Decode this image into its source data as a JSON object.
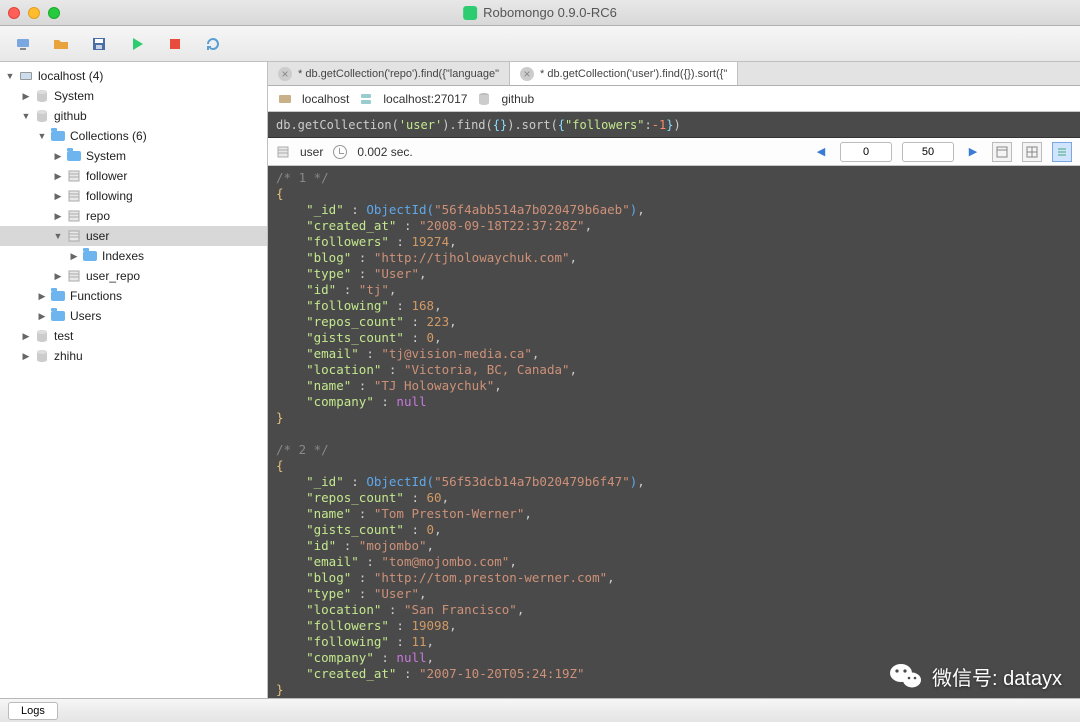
{
  "window": {
    "title": "Robomongo 0.9.0-RC6"
  },
  "sidebar": {
    "root": "localhost (4)",
    "dbs": [
      {
        "name": "System",
        "open": false
      },
      {
        "name": "github",
        "open": true,
        "collections_label": "Collections (6)",
        "collections": [
          "System",
          "follower",
          "following",
          "repo",
          "user",
          "user_repo"
        ],
        "indexes_label": "Indexes",
        "functions": "Functions",
        "users": "Users"
      },
      {
        "name": "test",
        "open": false
      },
      {
        "name": "zhihu",
        "open": false
      }
    ]
  },
  "tabs": [
    {
      "label": "* db.getCollection('repo').find({\"language\"",
      "active": false
    },
    {
      "label": "* db.getCollection('user').find({}).sort({\"",
      "active": true
    }
  ],
  "breadcrumb": {
    "host": "localhost",
    "server": "localhost:27017",
    "db": "github"
  },
  "query": {
    "prefix": "db.getCollection(",
    "collArg": "'user'",
    "mid1": ").find(",
    "arg1": "{}",
    "mid2": ").sort(",
    "sortOpen": "{",
    "sortKey": "\"followers\"",
    "sortColon": ": ",
    "sortVal": "-1",
    "sortClose": "}",
    "end": ")"
  },
  "result_toolbar": {
    "collection": "user",
    "time": "0.002 sec.",
    "skip": "0",
    "limit": "50"
  },
  "results": [
    {
      "header": "/* 1 */",
      "fields": [
        {
          "k": "_id",
          "type": "oid",
          "v": "56f4abb514a7b020479b6aeb"
        },
        {
          "k": "created_at",
          "type": "str",
          "v": "2008-09-18T22:37:28Z"
        },
        {
          "k": "followers",
          "type": "num",
          "v": "19274"
        },
        {
          "k": "blog",
          "type": "str",
          "v": "http://tjholowaychuk.com"
        },
        {
          "k": "type",
          "type": "str",
          "v": "User"
        },
        {
          "k": "id",
          "type": "str",
          "v": "tj"
        },
        {
          "k": "following",
          "type": "num",
          "v": "168"
        },
        {
          "k": "repos_count",
          "type": "num",
          "v": "223"
        },
        {
          "k": "gists_count",
          "type": "num",
          "v": "0"
        },
        {
          "k": "email",
          "type": "str",
          "v": "tj@vision-media.ca"
        },
        {
          "k": "location",
          "type": "str",
          "v": "Victoria, BC, Canada"
        },
        {
          "k": "name",
          "type": "str",
          "v": "TJ Holowaychuk"
        },
        {
          "k": "company",
          "type": "null",
          "v": "null"
        }
      ]
    },
    {
      "header": "/* 2 */",
      "fields": [
        {
          "k": "_id",
          "type": "oid",
          "v": "56f53dcb14a7b020479b6f47"
        },
        {
          "k": "repos_count",
          "type": "num",
          "v": "60"
        },
        {
          "k": "name",
          "type": "str",
          "v": "Tom Preston-Werner"
        },
        {
          "k": "gists_count",
          "type": "num",
          "v": "0"
        },
        {
          "k": "id",
          "type": "str",
          "v": "mojombo"
        },
        {
          "k": "email",
          "type": "str",
          "v": "tom@mojombo.com"
        },
        {
          "k": "blog",
          "type": "str",
          "v": "http://tom.preston-werner.com"
        },
        {
          "k": "type",
          "type": "str",
          "v": "User"
        },
        {
          "k": "location",
          "type": "str",
          "v": "San Francisco"
        },
        {
          "k": "followers",
          "type": "num",
          "v": "19098"
        },
        {
          "k": "following",
          "type": "num",
          "v": "11"
        },
        {
          "k": "company",
          "type": "null",
          "v": "null"
        },
        {
          "k": "created_at",
          "type": "str",
          "v": "2007-10-20T05:24:19Z"
        }
      ]
    }
  ],
  "statusbar": {
    "logs": "Logs"
  },
  "watermark": {
    "label": "微信号: datayx"
  }
}
